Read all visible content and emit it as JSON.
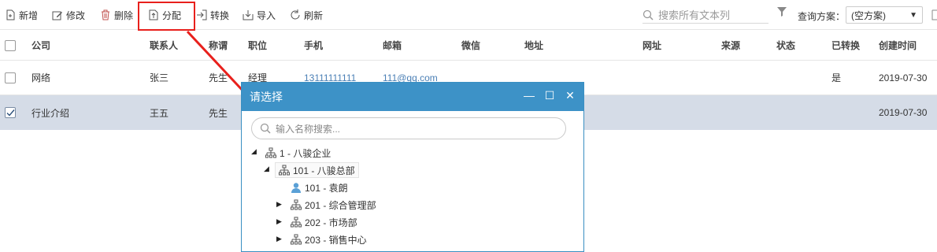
{
  "toolbar": {
    "new_label": "新增",
    "edit_label": "修改",
    "delete_label": "删除",
    "assign_label": "分配",
    "convert_label": "转换",
    "import_label": "导入",
    "refresh_label": "刷新",
    "search_placeholder": "搜索所有文本列",
    "scheme_label": "查询方案：",
    "scheme_value": "(空方案)"
  },
  "table": {
    "headers": [
      "公司",
      "联系人",
      "称谓",
      "职位",
      "手机",
      "邮箱",
      "微信",
      "地址",
      "网址",
      "来源",
      "状态",
      "已转换",
      "创建时间"
    ],
    "rows": [
      {
        "checked": false,
        "company": "网络",
        "contact": "张三",
        "title": "先生",
        "position": "经理",
        "mobile": "13111111111",
        "email": "111@qq.com",
        "converted": "是",
        "created": "2019-07-30"
      },
      {
        "checked": true,
        "company": "行业介绍",
        "contact": "王五",
        "title": "先生",
        "position": "",
        "mobile": "",
        "email": "",
        "converted": "",
        "created": "2019-07-30"
      }
    ]
  },
  "dialog": {
    "title": "请选择",
    "search_placeholder": "输入名称搜索...",
    "tree": [
      {
        "label": "1 - 八骏企业",
        "type": "org"
      },
      {
        "label": "101 - 八骏总部",
        "type": "org"
      },
      {
        "label": "101 - 袁朗",
        "type": "user"
      },
      {
        "label": "201 - 综合管理部",
        "type": "org"
      },
      {
        "label": "202 - 市场部",
        "type": "org"
      },
      {
        "label": "203 - 销售中心",
        "type": "org"
      }
    ]
  },
  "colors": {
    "accent": "#3d92c7",
    "highlight_red": "#e8201c",
    "selected_row": "#d5dce7"
  }
}
